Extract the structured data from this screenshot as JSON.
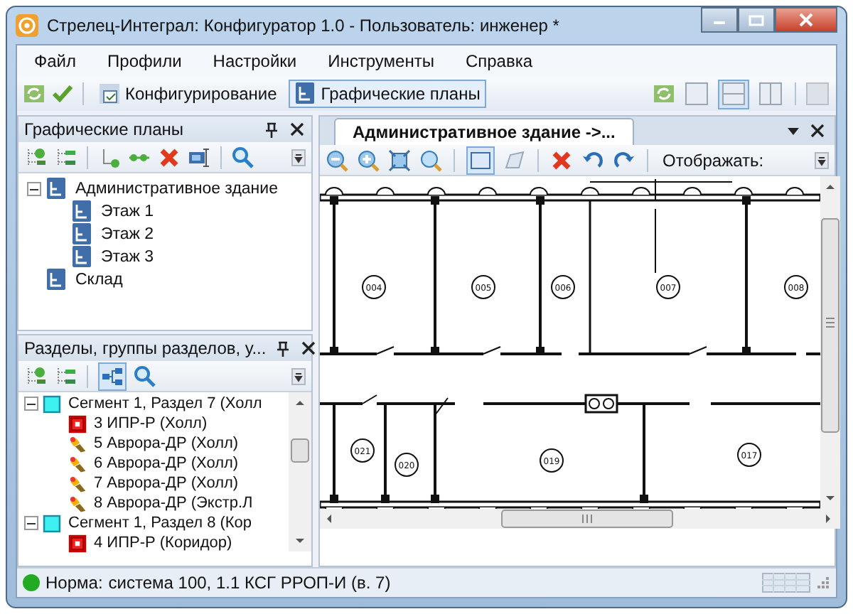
{
  "window": {
    "title": "Стрелец-Интеграл: Конфигуратор 1.0 - Пользователь: инженер *"
  },
  "menu": [
    {
      "label": "Файл"
    },
    {
      "label": "Профили"
    },
    {
      "label": "Настройки"
    },
    {
      "label": "Инструменты"
    },
    {
      "label": "Справка"
    }
  ],
  "toolbar": {
    "modes": [
      {
        "label": "Конфигурирование",
        "selected": false
      },
      {
        "label": "Графические планы",
        "selected": true
      }
    ],
    "layouts": [
      {
        "kind": "single",
        "selected": false
      },
      {
        "kind": "horizontal",
        "selected": true
      },
      {
        "kind": "vertical",
        "selected": false
      }
    ]
  },
  "plans_panel": {
    "title": "Графические планы",
    "tree": [
      {
        "label": "Административное здание",
        "expanded": true,
        "children": [
          {
            "label": "Этаж 1"
          },
          {
            "label": "Этаж 2"
          },
          {
            "label": "Этаж 3"
          }
        ]
      },
      {
        "label": "Склад"
      }
    ]
  },
  "sections_panel": {
    "title": "Разделы, группы разделов, у...",
    "tree": [
      {
        "label": "Сегмент 1, Раздел 7 (Холл",
        "kind": "segment",
        "expanded": true,
        "children": [
          {
            "label": "3 ИПР-Р (Холл)",
            "kind": "call-point"
          },
          {
            "label": "5 Аврора-ДР (Холл)",
            "kind": "detector"
          },
          {
            "label": "6 Аврора-ДР (Холл)",
            "kind": "detector"
          },
          {
            "label": "7 Аврора-ДР (Холл)",
            "kind": "detector"
          },
          {
            "label": "8 Аврора-ДР (Экстр.Л",
            "kind": "detector"
          }
        ]
      },
      {
        "label": "Сегмент 1, Раздел 8 (Кор",
        "kind": "segment",
        "expanded": true,
        "children": [
          {
            "label": "4 ИПР-Р (Коридор)",
            "kind": "call-point"
          }
        ]
      }
    ]
  },
  "document": {
    "tab": "Административное здание ->...",
    "display_label": "Отображать:",
    "rooms": [
      "004",
      "005",
      "006",
      "007",
      "008",
      "021",
      "020",
      "019",
      "017"
    ]
  },
  "status_bar": {
    "state": "Норма:",
    "text": "система 100, 1.1 КСГ РРОП-И (в. 7)"
  }
}
